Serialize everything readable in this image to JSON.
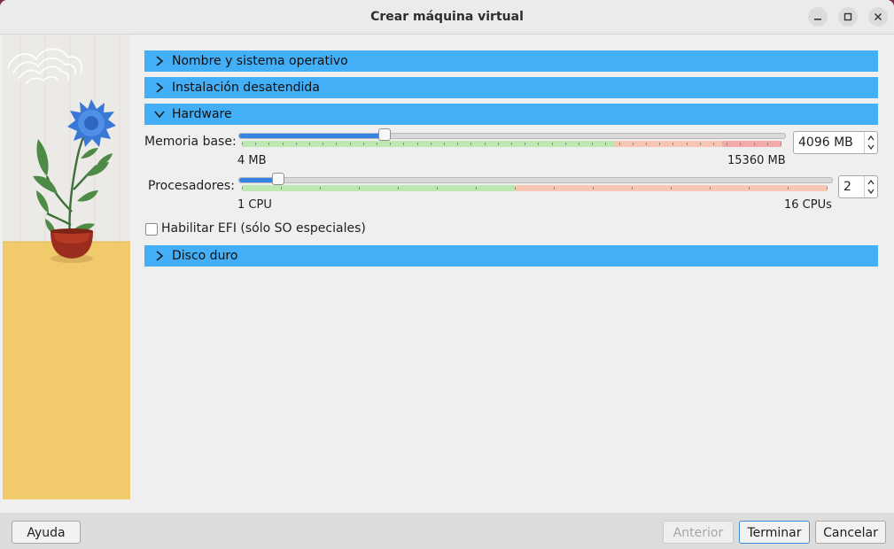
{
  "window": {
    "title": "Crear máquina virtual"
  },
  "sections": {
    "name_os": "Nombre y sistema operativo",
    "unattended": "Instalación desatendida",
    "hardware": "Hardware",
    "disk": "Disco duro"
  },
  "hardware": {
    "memory": {
      "label": "Memoria base:",
      "value": "4096 MB",
      "min_label": "4 MB",
      "max_label": "15360 MB",
      "level": 0.267
    },
    "cpu": {
      "label": "Procesadores:",
      "value": "2",
      "min_label": "1 CPU",
      "max_label": "16 CPUs",
      "level": 0.0667
    },
    "efi": {
      "label": "Habilitar EFI (sólo SO especiales)",
      "checked": false
    }
  },
  "buttons": {
    "help": "Ayuda",
    "back": "Anterior",
    "finish": "Terminar",
    "cancel": "Cancelar"
  },
  "colors": {
    "section_header": "#42aff7",
    "slider_fill": "#3584e4",
    "zone_green": "#bde8b1",
    "zone_orange": "#f7c7b3",
    "zone_red": "#f1a9a9"
  }
}
